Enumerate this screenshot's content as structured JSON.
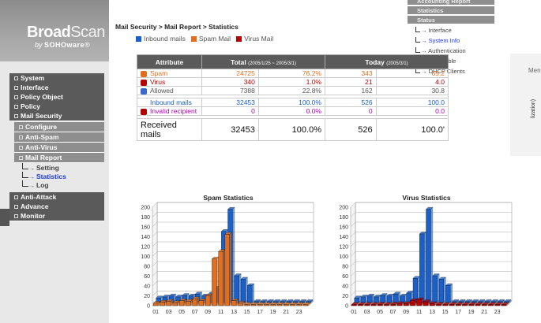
{
  "brand": {
    "name_bold": "Broad",
    "name_light": "Scan",
    "sub_prefix": "by ",
    "sub_brand": "SOHOware",
    "sub_suffix": "®"
  },
  "breadcrumb": "Mail Security > Mail Report > Statistics",
  "legend": [
    {
      "label": "Inbound mails",
      "color": "#1a60c8"
    },
    {
      "label": "Spam Mail",
      "color": "#e07020"
    },
    {
      "label": "Virus Mail",
      "color": "#b80000"
    }
  ],
  "nav": {
    "top_items": [
      "System",
      "Interface",
      "Policy Object",
      "Policy",
      "Mail Security"
    ],
    "mail_security_children": [
      "Configure",
      "Anti-Spam",
      "Anti-Virus",
      "Mail Report"
    ],
    "mail_report_children": [
      "Setting",
      "Statistics",
      "Log"
    ],
    "bottom_items": [
      "Anti-Attack",
      "Advance",
      "Monitor"
    ]
  },
  "top_menu": {
    "bars": [
      "Accounting Report",
      "Statistics",
      "Status"
    ],
    "leaves": [
      "Interface",
      "System Info",
      "Authentication",
      "ARP Table",
      "DHCP Clients"
    ],
    "side_label": "Men",
    "side_note": "lization)"
  },
  "table": {
    "headers": {
      "attribute": "Attribute",
      "total": "Total",
      "total_range": "(2005/1/25 ~ 2005/3/1)",
      "today": "Today",
      "today_date": "(2005/3/1)"
    },
    "rows": [
      {
        "label": "Spam",
        "total": "24725",
        "total_pct": "76.2%",
        "today": "343",
        "today_pct": "65.2"
      },
      {
        "label": "Virus",
        "total": "340",
        "total_pct": "1.0%",
        "today": "21",
        "today_pct": "4.0"
      },
      {
        "label": "Allowed",
        "total": "7388",
        "total_pct": "22.8%",
        "today": "162",
        "today_pct": "30.8"
      },
      {
        "label": "Inbound mails",
        "total": "32453",
        "total_pct": "100.0%",
        "today": "526",
        "today_pct": "100.0"
      },
      {
        "label": "Invalid recipient",
        "total": "0",
        "total_pct": "0.0%",
        "today": "0",
        "today_pct": "0.0"
      },
      {
        "label": "Received mails",
        "total": "32453",
        "total_pct": "100.0%",
        "today": "526",
        "today_pct": "100.0'"
      }
    ]
  },
  "chart_data": [
    {
      "type": "bar",
      "title": "Spam Statistics",
      "categories": [
        "01",
        "02",
        "03",
        "04",
        "05",
        "06",
        "07",
        "08",
        "09",
        "10",
        "11",
        "12",
        "13",
        "14",
        "15",
        "16",
        "17",
        "18",
        "19",
        "20",
        "21",
        "22",
        "23",
        "24"
      ],
      "series": [
        {
          "color": "#1a60c8",
          "values": [
            10,
            12,
            14,
            12,
            15,
            14,
            18,
            14,
            18,
            30,
            145,
            190,
            55,
            48,
            35,
            0,
            0,
            0,
            0,
            0,
            0,
            0,
            0,
            0
          ]
        },
        {
          "color": "#e07020",
          "values": [
            5,
            7,
            9,
            6,
            10,
            9,
            14,
            10,
            20,
            95,
            110,
            145,
            10,
            5,
            2,
            0,
            0,
            0,
            0,
            0,
            0,
            0,
            0,
            0
          ]
        }
      ],
      "ylim": [
        0,
        200
      ],
      "yticks": [
        0,
        20,
        40,
        60,
        80,
        100,
        120,
        140,
        160,
        180,
        200
      ],
      "xticks": [
        "01",
        "03",
        "05",
        "07",
        "09",
        "11",
        "13",
        "15",
        "17",
        "19",
        "21",
        "23"
      ]
    },
    {
      "type": "bar",
      "title": "Virus Statistics",
      "categories": [
        "01",
        "02",
        "03",
        "04",
        "05",
        "06",
        "07",
        "08",
        "09",
        "10",
        "11",
        "12",
        "13",
        "14",
        "15",
        "16",
        "17",
        "18",
        "19",
        "20",
        "21",
        "22",
        "23",
        "24"
      ],
      "series": [
        {
          "color": "#1a60c8",
          "values": [
            10,
            12,
            14,
            12,
            15,
            14,
            18,
            14,
            20,
            50,
            140,
            190,
            55,
            48,
            35,
            0,
            0,
            0,
            0,
            0,
            0,
            0,
            0,
            0
          ]
        },
        {
          "color": "#b80000",
          "values": [
            1,
            1,
            2,
            2,
            3,
            2,
            3,
            4,
            4,
            10,
            12,
            8,
            4,
            3,
            2,
            1,
            1,
            1,
            1,
            1,
            1,
            1,
            1,
            1
          ]
        }
      ],
      "ylim": [
        0,
        200
      ],
      "yticks": [
        0,
        20,
        40,
        60,
        80,
        100,
        120,
        140,
        160,
        180,
        200
      ],
      "xticks": [
        "01",
        "03",
        "05",
        "07",
        "09",
        "11",
        "13",
        "15",
        "17",
        "19",
        "21",
        "23"
      ]
    }
  ]
}
